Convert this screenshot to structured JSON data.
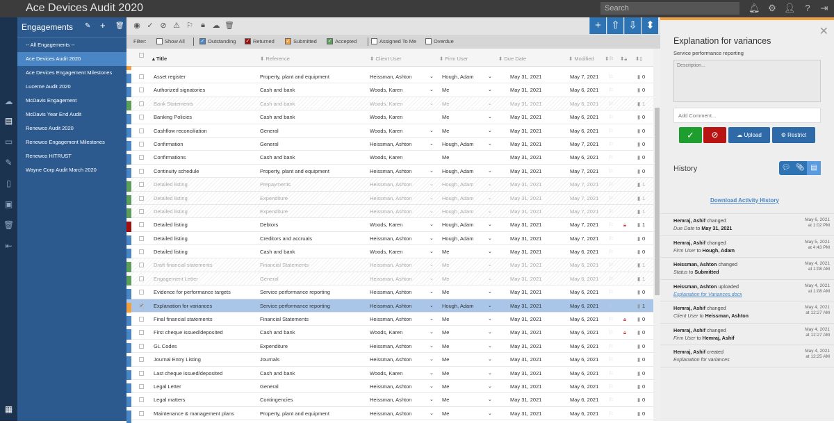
{
  "app": {
    "title": "Ace Devices Audit 2020",
    "search_placeholder": "Search"
  },
  "sidebar": {
    "title": "Engagements",
    "items": [
      "-- All Engagements --",
      "Ace Devices Audit 2020",
      "Ace Devices Engagement Milestones",
      "Lucerne Audit 2020",
      "McDavis Engagement",
      "McDavis Year End Audit",
      "Renewco Audit 2020",
      "Renewco Engagement Milestones",
      "Renewco HITRUST",
      "Wayne Corp Audit March 2020"
    ],
    "active_index": 1
  },
  "filters": {
    "label": "Filter:",
    "options": [
      {
        "label": "Show All",
        "checked": false,
        "color": "#ffffff"
      },
      {
        "label": "Outstanding",
        "checked": true,
        "color": "#4a86c5"
      },
      {
        "label": "Returned",
        "checked": true,
        "color": "#a01010"
      },
      {
        "label": "Submitted",
        "checked": true,
        "color": "#f0a040"
      },
      {
        "label": "Accepted",
        "checked": true,
        "color": "#5a9e5a"
      },
      {
        "label": "Assigned To Me",
        "checked": false,
        "color": "#ffffff"
      },
      {
        "label": "Overdue",
        "checked": false,
        "color": "#ffffff"
      }
    ]
  },
  "columns": {
    "title": "Title",
    "reference": "Reference",
    "client": "Client User",
    "firm": "Firm User",
    "due": "Due Date",
    "modified": "Modified"
  },
  "status_colors": {
    "outstanding": "#4a86c5",
    "accepted": "#5a9e5a",
    "returned": "#a01010",
    "submitted": "#f0a040"
  },
  "rows": [
    {
      "title": "Asset register",
      "reference": "Property, plant and equipment",
      "client": "Heissman, Ashton",
      "firm": "Hough, Adam",
      "due": "May 31, 2021",
      "modified": "May 7, 2021",
      "files": "0",
      "status": "outstanding",
      "cc": true,
      "fc": true,
      "lock": false
    },
    {
      "title": "Authorized signatories",
      "reference": "Cash and bank",
      "client": "Woods, Karen",
      "firm": "Me",
      "due": "May 31, 2021",
      "modified": "May 6, 2021",
      "files": "0",
      "status": "outstanding",
      "cc": true,
      "fc": true,
      "lock": false
    },
    {
      "title": "Bank Statements",
      "reference": "Cash and bank",
      "client": "Woods, Karen",
      "firm": "Me",
      "due": "May 31, 2021",
      "modified": "May 6, 2021",
      "files": "1",
      "status": "accepted",
      "cc": true,
      "fc": true,
      "lock": false
    },
    {
      "title": "Banking Policies",
      "reference": "Cash and bank",
      "client": "Woods, Karen",
      "firm": "Me",
      "due": "May 31, 2021",
      "modified": "May 6, 2021",
      "files": "0",
      "status": "outstanding",
      "cc": false,
      "fc": true,
      "lock": false
    },
    {
      "title": "Cashflow reconciliation",
      "reference": "General",
      "client": "Woods, Karen",
      "firm": "Me",
      "due": "May 31, 2021",
      "modified": "May 6, 2021",
      "files": "0",
      "status": "outstanding",
      "cc": true,
      "fc": true,
      "lock": false
    },
    {
      "title": "Confirmation",
      "reference": "General",
      "client": "Heissman, Ashton",
      "firm": "Hough, Adam",
      "due": "May 31, 2021",
      "modified": "May 7, 2021",
      "files": "0",
      "status": "outstanding",
      "cc": true,
      "fc": true,
      "lock": false
    },
    {
      "title": "Confirmations",
      "reference": "Cash and bank",
      "client": "Woods, Karen",
      "firm": "Me",
      "due": "May 31, 2021",
      "modified": "May 6, 2021",
      "files": "0",
      "status": "outstanding",
      "cc": false,
      "fc": false,
      "lock": false
    },
    {
      "title": "Continuity schedule",
      "reference": "Property, plant and equipment",
      "client": "Heissman, Ashton",
      "firm": "Hough, Adam",
      "due": "May 31, 2021",
      "modified": "May 7, 2021",
      "files": "0",
      "status": "outstanding",
      "cc": true,
      "fc": true,
      "lock": false
    },
    {
      "title": "Detailed listing",
      "reference": "Prepayments",
      "client": "Heissman, Ashton",
      "firm": "Hough, Adam",
      "due": "May 31, 2021",
      "modified": "May 7, 2021",
      "files": "1",
      "status": "accepted",
      "cc": true,
      "fc": true,
      "lock": false
    },
    {
      "title": "Detailed listing",
      "reference": "Expenditure",
      "client": "Heissman, Ashton",
      "firm": "Hough, Adam",
      "due": "May 31, 2021",
      "modified": "May 7, 2021",
      "files": "1",
      "status": "accepted",
      "cc": true,
      "fc": true,
      "lock": false
    },
    {
      "title": "Detailed listing",
      "reference": "Expenditure",
      "client": "Heissman, Ashton",
      "firm": "Hough, Adam",
      "due": "May 31, 2021",
      "modified": "May 7, 2021",
      "files": "1",
      "status": "accepted",
      "cc": true,
      "fc": true,
      "lock": false
    },
    {
      "title": "Detailed listing",
      "reference": "Debtors",
      "client": "Woods, Karen",
      "firm": "Hough, Adam",
      "due": "May 31, 2021",
      "modified": "May 7, 2021",
      "files": "1",
      "status": "returned",
      "cc": true,
      "fc": true,
      "lock": true
    },
    {
      "title": "Detailed listing",
      "reference": "Creditors and accruals",
      "client": "Heissman, Ashton",
      "firm": "Hough, Adam",
      "due": "May 31, 2021",
      "modified": "May 7, 2021",
      "files": "0",
      "status": "outstanding",
      "cc": true,
      "fc": true,
      "lock": false
    },
    {
      "title": "Detailed listing",
      "reference": "Cash and bank",
      "client": "Woods, Karen",
      "firm": "Me",
      "due": "May 31, 2021",
      "modified": "May 6, 2021",
      "files": "0",
      "status": "outstanding",
      "cc": true,
      "fc": true,
      "lock": false
    },
    {
      "title": "Draft financial statements",
      "reference": "Financial Statements",
      "client": "Heissman, Ashton",
      "firm": "Me",
      "due": "May 31, 2021",
      "modified": "May 6, 2021",
      "files": "1",
      "status": "accepted",
      "cc": true,
      "fc": true,
      "lock": false
    },
    {
      "title": "Engagement Letter",
      "reference": "General",
      "client": "Heissman, Ashton",
      "firm": "Me",
      "due": "May 31, 2021",
      "modified": "May 6, 2021",
      "files": "1",
      "status": "accepted",
      "cc": true,
      "fc": true,
      "lock": false
    },
    {
      "title": "Evidence for performance targets",
      "reference": "Service performance reporting",
      "client": "Heissman, Ashton",
      "firm": "Me",
      "due": "May 31, 2021",
      "modified": "May 6, 2021",
      "files": "0",
      "status": "outstanding",
      "cc": true,
      "fc": true,
      "lock": false
    },
    {
      "title": "Explanation for variances",
      "reference": "Service performance reporting",
      "client": "Heissman, Ashton",
      "firm": "Hough, Adam",
      "due": "May 31, 2021",
      "modified": "May 6, 2021",
      "files": "1",
      "status": "submitted",
      "cc": true,
      "fc": true,
      "lock": false,
      "selected": true
    },
    {
      "title": "Final financial statements",
      "reference": "Financial Statements",
      "client": "Heissman, Ashton",
      "firm": "Me",
      "due": "May 31, 2021",
      "modified": "May 6, 2021",
      "files": "0",
      "status": "outstanding",
      "cc": true,
      "fc": true,
      "lock": true
    },
    {
      "title": "First cheque issued/deposited",
      "reference": "Cash and bank",
      "client": "Woods, Karen",
      "firm": "Me",
      "due": "May 31, 2021",
      "modified": "May 6, 2021",
      "files": "0",
      "status": "outstanding",
      "cc": true,
      "fc": true,
      "lock": true
    },
    {
      "title": "GL Codes",
      "reference": "Expenditure",
      "client": "Heissman, Ashton",
      "firm": "Me",
      "due": "May 31, 2021",
      "modified": "May 6, 2021",
      "files": "0",
      "status": "outstanding",
      "cc": true,
      "fc": true,
      "lock": false
    },
    {
      "title": "Journal Entry Listing",
      "reference": "Journals",
      "client": "Heissman, Ashton",
      "firm": "Me",
      "due": "May 31, 2021",
      "modified": "May 6, 2021",
      "files": "0",
      "status": "outstanding",
      "cc": true,
      "fc": true,
      "lock": false
    },
    {
      "title": "Last cheque issued/deposited",
      "reference": "Cash and bank",
      "client": "Woods, Karen",
      "firm": "Me",
      "due": "May 31, 2021",
      "modified": "May 6, 2021",
      "files": "0",
      "status": "outstanding",
      "cc": true,
      "fc": true,
      "lock": false
    },
    {
      "title": "Legal Letter",
      "reference": "General",
      "client": "Heissman, Ashton",
      "firm": "Me",
      "due": "May 31, 2021",
      "modified": "May 6, 2021",
      "files": "0",
      "status": "outstanding",
      "cc": true,
      "fc": true,
      "lock": false
    },
    {
      "title": "Legal matters",
      "reference": "Contingencies",
      "client": "Heissman, Ashton",
      "firm": "Me",
      "due": "May 31, 2021",
      "modified": "May 6, 2021",
      "files": "0",
      "status": "outstanding",
      "cc": true,
      "fc": true,
      "lock": false
    },
    {
      "title": "Maintenance & management plans",
      "reference": "Property, plant and equipment",
      "client": "Heissman, Ashton",
      "firm": "Me",
      "due": "May 31, 2021",
      "modified": "May 6, 2021",
      "files": "0",
      "status": "outstanding",
      "cc": true,
      "fc": true,
      "lock": false
    }
  ],
  "detail": {
    "title": "Explanation for variances",
    "subtitle": "Service performance reporting",
    "description_placeholder": "Description...",
    "comment_placeholder": "Add Comment...",
    "upload_label": "Upload",
    "restrict_label": "Restrict",
    "history_title": "History",
    "download_label": "Download Activity History"
  },
  "history": [
    {
      "user": "Hemraj, Ashif",
      "action": "changed",
      "field": "Due Date",
      "to": "to",
      "value": "May 31, 2021",
      "date": "May 6, 2021",
      "time": "at 1:02 PM"
    },
    {
      "user": "Hemraj, Ashif",
      "action": "changed",
      "field": "Firm User",
      "to": "to",
      "value": "Hough, Adam",
      "date": "May 5, 2021",
      "time": "at 4:43 PM"
    },
    {
      "user": "Heissman, Ashton",
      "action": "changed",
      "field": "Status",
      "to": "to",
      "value": "Submitted",
      "date": "May 4, 2021",
      "time": "at 1:08 AM"
    },
    {
      "user": "Heissman, Ashton",
      "action": "uploaded",
      "link": "Explanation for Variances.docx",
      "date": "May 4, 2021",
      "time": "at 1:08 AM"
    },
    {
      "user": "Hemraj, Ashif",
      "action": "changed",
      "field": "Client User",
      "to": "to",
      "value": "Heissman, Ashton",
      "date": "May 4, 2021",
      "time": "at 12:27 AM"
    },
    {
      "user": "Hemraj, Ashif",
      "action": "changed",
      "field": "Firm User",
      "to": "to",
      "value": "Hemraj, Ashif",
      "date": "May 4, 2021",
      "time": "at 12:27 AM"
    },
    {
      "user": "Hemraj, Ashif",
      "action": "created",
      "field": "Explanation for variances",
      "date": "May 4, 2021",
      "time": "at 12:25 AM"
    }
  ]
}
